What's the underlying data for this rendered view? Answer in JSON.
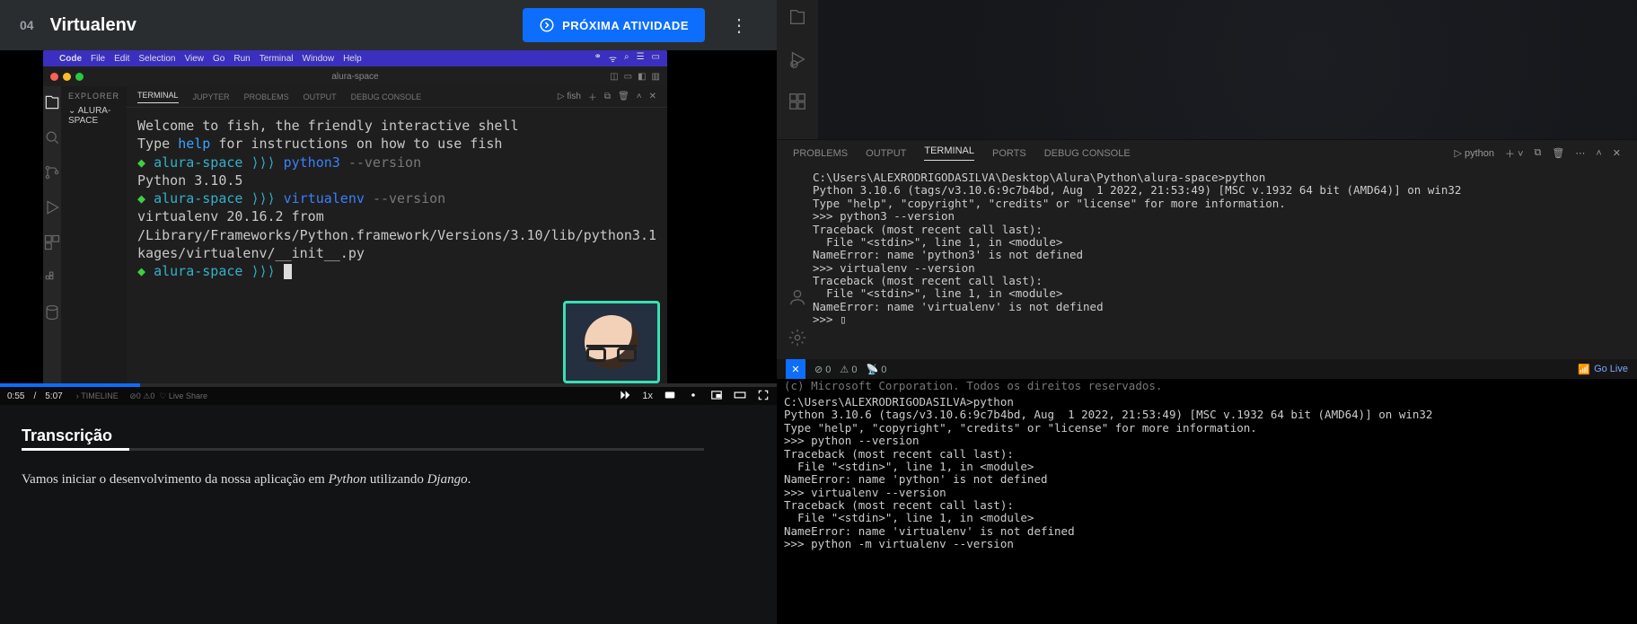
{
  "lesson": {
    "number": "04",
    "title": "Virtualenv",
    "next_label": "PRÓXIMA ATIVIDADE"
  },
  "video": {
    "mac_menu": {
      "apple": "",
      "app": "Code",
      "items": [
        "File",
        "Edit",
        "Selection",
        "View",
        "Go",
        "Run",
        "Terminal",
        "Window",
        "Help"
      ],
      "right": [
        "bt",
        "wifi",
        "search",
        "cc",
        "battery"
      ]
    },
    "window_title": "alura-space",
    "sidebar": {
      "header": "EXPLORER",
      "folder": "ALURA-SPACE"
    },
    "panel_tabs": [
      "TERMINAL",
      "JUPYTER",
      "PROBLEMS",
      "OUTPUT",
      "DEBUG CONSOLE"
    ],
    "panel_tabs_active": "TERMINAL",
    "shell_label": "fish",
    "fish": {
      "welcome": "Welcome to fish, the friendly interactive shell",
      "type": "Type ",
      "help": "help",
      "type2": " for instructions on how to use fish",
      "arrow": "◆ ",
      "folder": "alura-space",
      "sep": " ⟩⟩⟩ ",
      "cmd1": "python3 ",
      "flag1": "--version",
      "out1": "Python 3.10.5",
      "cmd2": "virtualenv ",
      "flag2": "--version",
      "out2": "virtualenv 20.16.2 from /Library/Frameworks/Python.framework/Versions/3.10/lib/python3.1  kages/virtualenv/__init__.py"
    },
    "time_cur": "0:55",
    "time_sep": " / ",
    "time_dur": "5:07",
    "timeline_label": "TIMELINE",
    "speed": "1x"
  },
  "transcript": {
    "heading": "Transcrição",
    "body_a": "Vamos iniciar o desenvolvimento da nossa aplicação em ",
    "body_i1": "Python",
    "body_b": " utilizando ",
    "body_i2": "Django",
    "body_c": "."
  },
  "right_vscode": {
    "panel_tabs": [
      "PROBLEMS",
      "OUTPUT",
      "TERMINAL",
      "PORTS",
      "DEBUG CONSOLE"
    ],
    "panel_active": "TERMINAL",
    "shell_label": "python",
    "term_text": "C:\\Users\\ALEXRODRIGODASILVA\\Desktop\\Alura\\Python\\alura-space>python\nPython 3.10.6 (tags/v3.10.6:9c7b4bd, Aug  1 2022, 21:53:49) [MSC v.1932 64 bit (AMD64)] on win32\nType \"help\", \"copyright\", \"credits\" or \"license\" for more information.\n>>> python3 --version\nTraceback (most recent call last):\n  File \"<stdin>\", line 1, in <module>\nNameError: name 'python3' is not defined\n>>> virtualenv --version\nTraceback (most recent call last):\n  File \"<stdin>\", line 1, in <module>\nNameError: name 'virtualenv' is not defined\n>>> ▯",
    "status": {
      "errors": "0",
      "warnings": "0",
      "ports": "0",
      "golive": "Go Live",
      "corp": "(c) Microsoft Corporation. Todos os direitos reservados."
    },
    "lower_term": "C:\\Users\\ALEXRODRIGODASILVA>python\nPython 3.10.6 (tags/v3.10.6:9c7b4bd, Aug  1 2022, 21:53:49) [MSC v.1932 64 bit (AMD64)] on win32\nType \"help\", \"copyright\", \"credits\" or \"license\" for more information.\n>>> python --version\nTraceback (most recent call last):\n  File \"<stdin>\", line 1, in <module>\nNameError: name 'python' is not defined\n>>> virtualenv --version\nTraceback (most recent call last):\n  File \"<stdin>\", line 1, in <module>\nNameError: name 'virtualenv' is not defined\n>>> python -m virtualenv --version"
  }
}
